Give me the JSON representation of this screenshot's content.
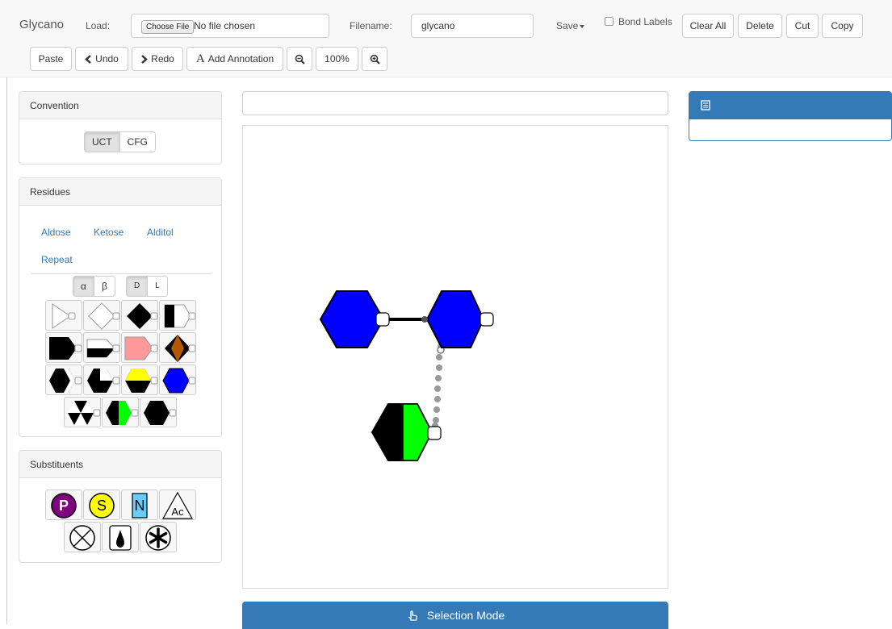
{
  "app": {
    "brand": "Glycano"
  },
  "toolbar": {
    "load_label": "Load:",
    "choose_file_label": "Choose File",
    "file_status": "No file chosen",
    "filename_label": "Filename:",
    "filename_value": "glycano",
    "save_label": "Save",
    "bond_labels_label": "Bond Labels",
    "bond_labels_checked": false,
    "clear_all_label": "Clear All",
    "delete_label": "Delete",
    "cut_label": "Cut",
    "copy_label": "Copy",
    "paste_label": "Paste",
    "undo_label": "Undo",
    "redo_label": "Redo",
    "add_annotation_label": "Add Annotation",
    "zoom_level": "100%"
  },
  "convention": {
    "title": "Convention",
    "options": [
      "UCT",
      "CFG"
    ],
    "selected": "UCT"
  },
  "residues": {
    "title": "Residues",
    "links": [
      "Aldose",
      "Ketose",
      "Alditol",
      "Repeat"
    ],
    "anomer_options": [
      "α",
      "β"
    ],
    "anomer_selected": "α",
    "config_options": [
      "D",
      "L"
    ],
    "config_selected": "D"
  },
  "substituents": {
    "title": "Substituents",
    "symbols": {
      "phosphate": "P",
      "sulfate": "S",
      "amino": "N",
      "acetyl": "Ac"
    }
  },
  "canvas": {
    "annotation_value": "",
    "mode_label": "Selection Mode",
    "colors": {
      "blue": "#0000ff",
      "green": "#00ff00",
      "black": "#000000"
    }
  },
  "icons": {
    "zoom_out": "zoom-out-icon",
    "zoom_in": "zoom-in-icon",
    "undo": "chevron-left-icon",
    "redo": "chevron-right-icon",
    "hand": "hand-pointer-icon",
    "list": "list-icon"
  }
}
